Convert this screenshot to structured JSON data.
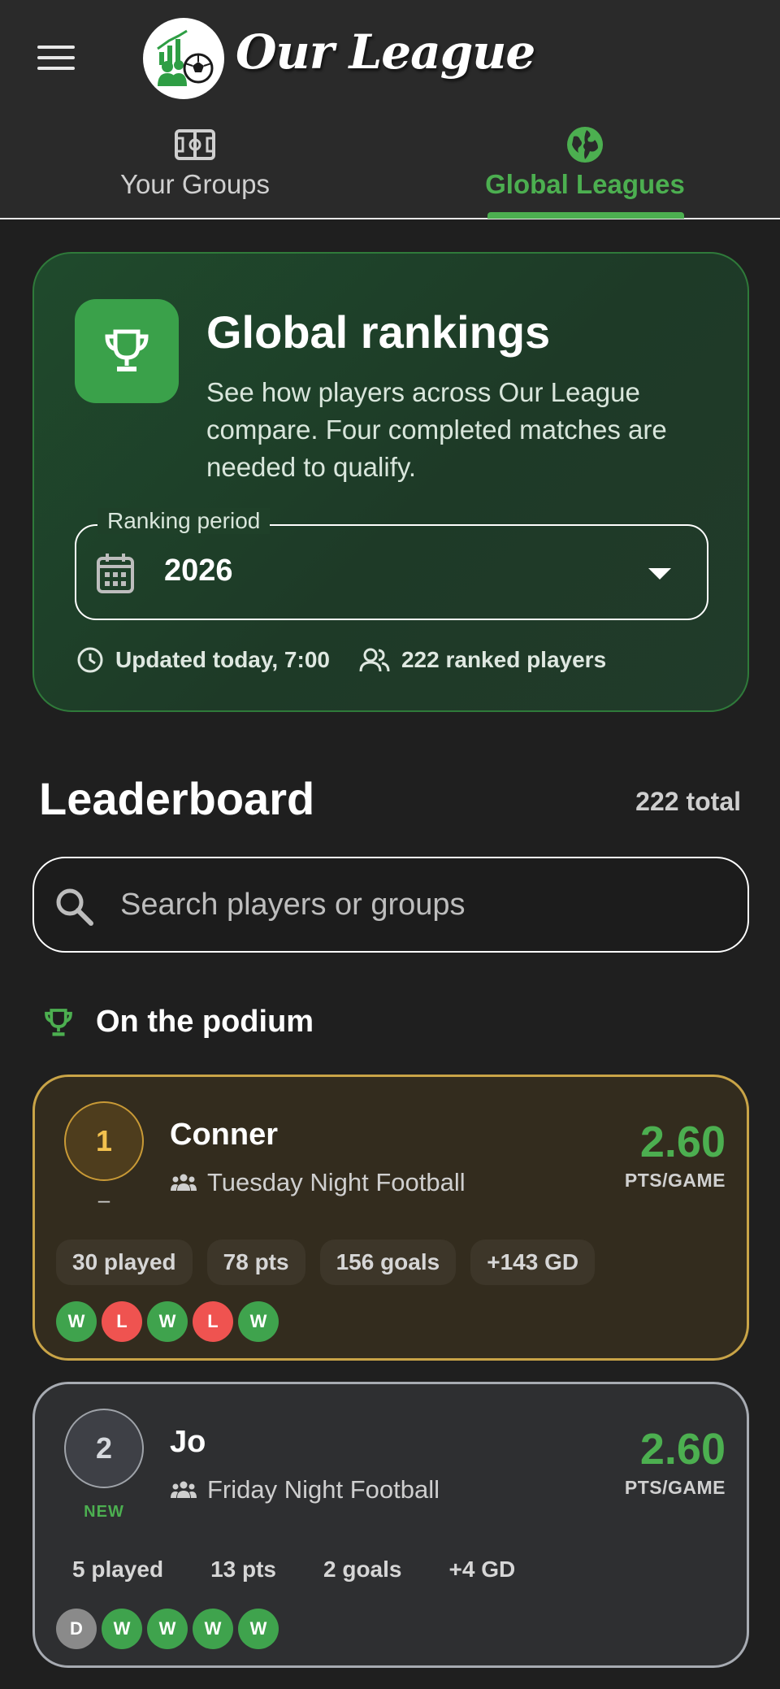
{
  "header": {
    "brand": "Our League",
    "menu_icon": "hamburger-menu-icon",
    "logo_icon": "league-logo-icon"
  },
  "tabs": [
    {
      "label": "Your Groups",
      "icon": "pitch-icon",
      "active": false
    },
    {
      "label": "Global Leagues",
      "icon": "globe-icon",
      "active": true
    }
  ],
  "colors": {
    "accent": "#4caf50",
    "gold": "#c9a447",
    "silver": "#a7abb2",
    "win": "#3fa34d",
    "loss": "#ef5350",
    "draw": "#8a8a8a"
  },
  "hero": {
    "title": "Global rankings",
    "description": "See how players across Our League compare. Four completed matches are needed to qualify.",
    "period_label": "Ranking period",
    "period_value": "2026",
    "updated": "Updated today, 7:00",
    "ranked_players": "222 ranked players"
  },
  "leaderboard": {
    "title": "Leaderboard",
    "total": "222 total",
    "search_placeholder": "Search players or groups",
    "podium_label": "On the podium",
    "players": [
      {
        "rank": "1",
        "change": "–",
        "name": "Conner",
        "group": "Tuesday Night Football",
        "score": "2.60",
        "score_unit": "PTS/GAME",
        "stats": [
          "30 played",
          "78 pts",
          "156 goals",
          "+143 GD"
        ],
        "form": [
          "W",
          "L",
          "W",
          "L",
          "W"
        ]
      },
      {
        "rank": "2",
        "change": "NEW",
        "name": "Jo",
        "group": "Friday Night Football",
        "score": "2.60",
        "score_unit": "PTS/GAME",
        "stats": [
          "5 played",
          "13 pts",
          "2 goals",
          "+4 GD"
        ],
        "form": [
          "D",
          "W",
          "W",
          "W",
          "W"
        ]
      }
    ]
  }
}
